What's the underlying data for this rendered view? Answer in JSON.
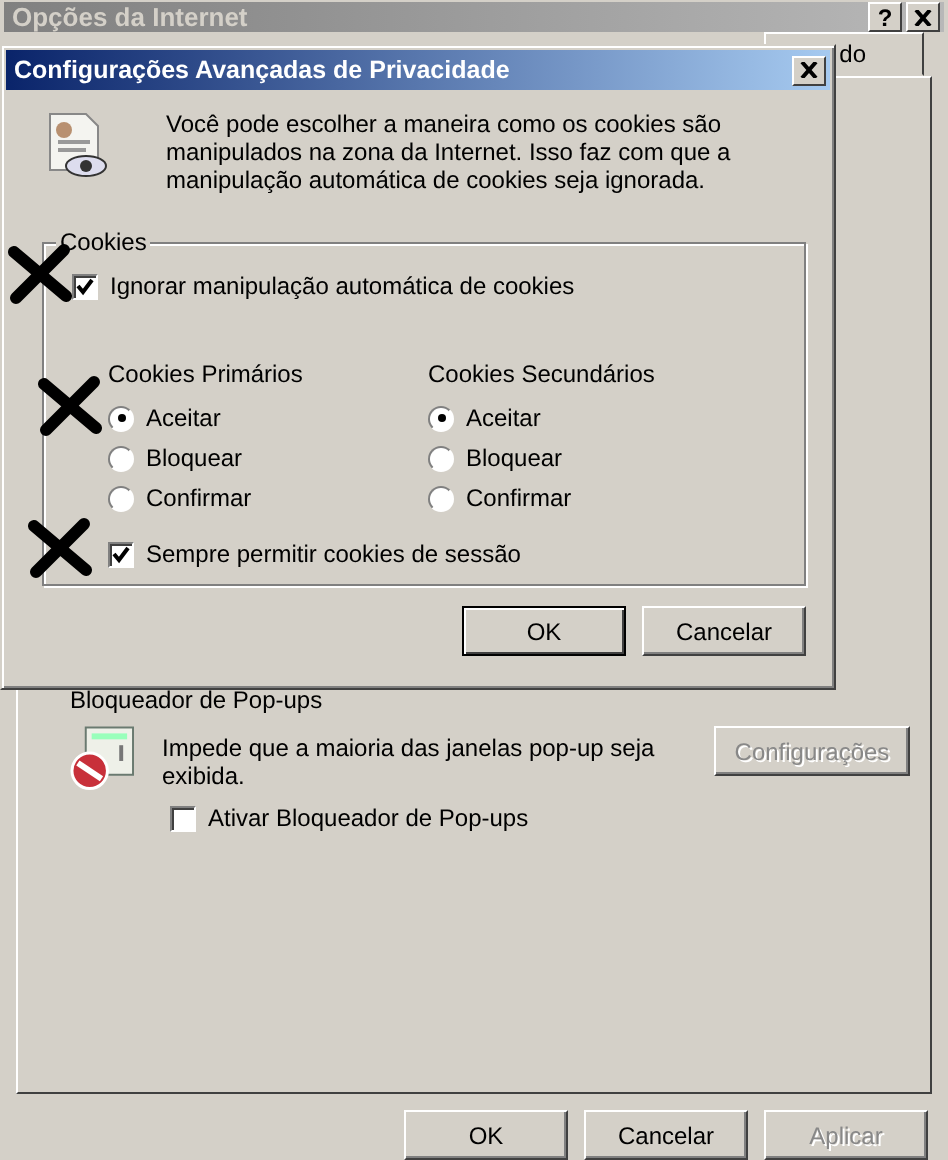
{
  "window": {
    "title": "Opções da Internet",
    "help_button": "?"
  },
  "tab_fragment": "do",
  "popup_blocker": {
    "title": "Bloqueador de Pop-ups",
    "description": "Impede que a maioria das janelas pop-up seja exibida.",
    "settings_button": {
      "label": "Configurações",
      "disabled": true
    },
    "checkbox": {
      "label": "Ativar Bloqueador de Pop-ups",
      "checked": false
    }
  },
  "buttons": [
    {
      "label": "OK",
      "disabled": false
    },
    {
      "label": "Cancelar",
      "disabled": false
    },
    {
      "label": "Aplicar",
      "disabled": true
    }
  ],
  "dialog": {
    "title": "Configurações Avançadas de Privacidade",
    "intro": "Você pode escolher a maneira como os cookies são manipulados na zona da Internet. Isso faz com que a manipulação automática de cookies seja ignorada.",
    "group_title": "Cookies",
    "override": {
      "label": "Ignorar manipulação automática de cookies",
      "checked": true
    },
    "columns": [
      {
        "title": "Cookies Primários",
        "options": [
          {
            "label": "Aceitar",
            "selected": true
          },
          {
            "label": "Bloquear",
            "selected": false
          },
          {
            "label": "Confirmar",
            "selected": false
          }
        ]
      },
      {
        "title": "Cookies Secundários",
        "options": [
          {
            "label": "Aceitar",
            "selected": true
          },
          {
            "label": "Bloquear",
            "selected": false
          },
          {
            "label": "Confirmar",
            "selected": false
          }
        ]
      }
    ],
    "session": {
      "label": "Sempre permitir cookies de sessão",
      "checked": true
    },
    "buttons": [
      {
        "label": "OK",
        "default": true
      },
      {
        "label": "Cancelar",
        "default": false
      }
    ]
  }
}
